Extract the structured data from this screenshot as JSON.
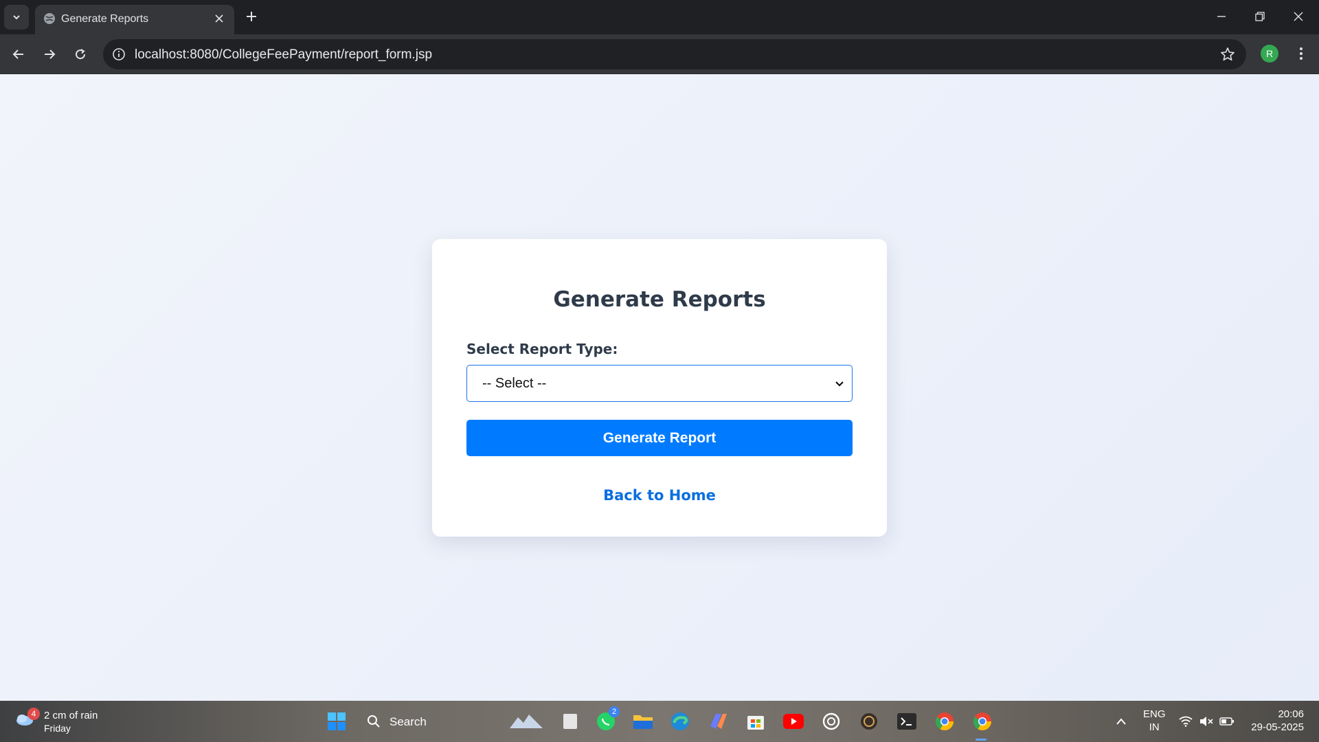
{
  "browser": {
    "tab_title": "Generate Reports",
    "url": "localhost:8080/CollegeFeePayment/report_form.jsp",
    "profile_initial": "R"
  },
  "page": {
    "title": "Generate Reports",
    "field_label": "Select Report Type:",
    "select_value": "-- Select --",
    "submit_label": "Generate Report",
    "home_link": "Back to Home",
    "colors": {
      "primary": "#007bff",
      "link": "#0a6fe0",
      "heading": "#2f3b4a",
      "background": "#eef2fa"
    }
  },
  "taskbar": {
    "weather_badge": "4",
    "weather_title": "2 cm of rain",
    "weather_day": "Friday",
    "search_label": "Search",
    "whatsapp_badge": "2",
    "lang_top": "ENG",
    "lang_bottom": "IN",
    "time": "20:06",
    "date": "29-05-2025",
    "icons": [
      "windows-start-icon",
      "search-icon",
      "widgets-icon",
      "file-icon",
      "whatsapp-icon",
      "file-explorer-icon",
      "edge-icon",
      "copilot-icon",
      "store-icon",
      "youtube-icon",
      "chatgpt-icon",
      "app-icon",
      "terminal-icon",
      "chrome-icon",
      "chrome-profile-icon",
      "chevron-up-icon",
      "wifi-icon",
      "volume-muted-icon",
      "battery-icon"
    ]
  }
}
